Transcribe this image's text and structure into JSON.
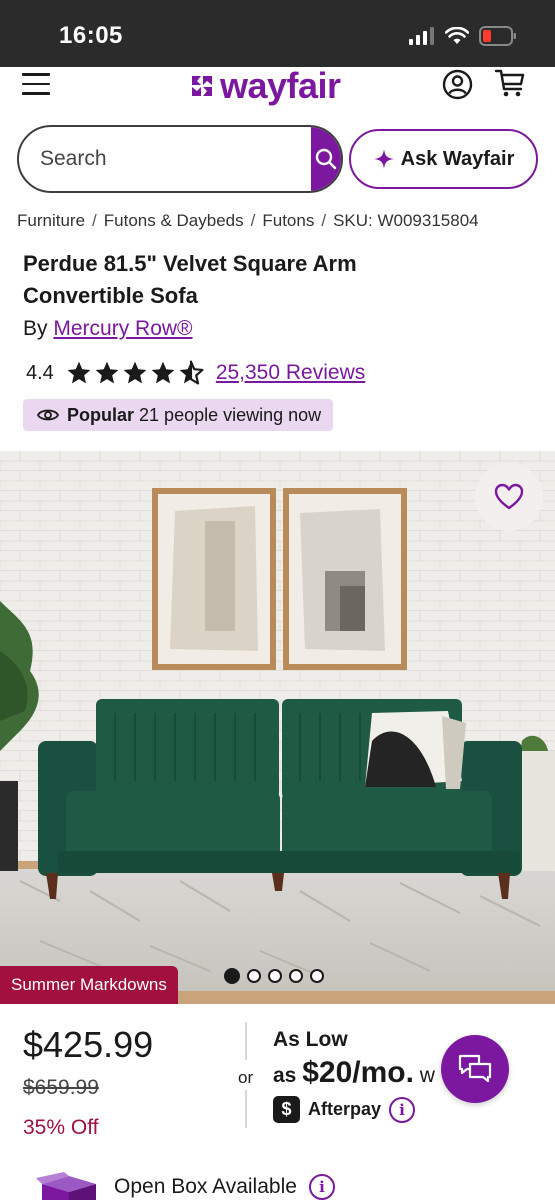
{
  "status_bar": {
    "time": "16:05"
  },
  "header": {
    "logo_text": "wayfair"
  },
  "search": {
    "placeholder": "Search"
  },
  "ask_button": {
    "label": "Ask Wayfair"
  },
  "breadcrumb": [
    "Furniture",
    "Futons & Daybeds",
    "Futons",
    "SKU: W009315804"
  ],
  "product": {
    "title": "Perdue 81.5\" Velvet Square Arm Convertible Sofa",
    "brand_prefix": "By",
    "brand": "Mercury Row®",
    "rating": "4.4",
    "stars": 4.4,
    "reviews": "25,350 Reviews",
    "popular_label": "Popular",
    "popular_text": "21 people viewing now"
  },
  "gallery": {
    "tag": "Summer Markdowns",
    "image_count": 5,
    "active_index": 0
  },
  "pricing": {
    "price": "$425.99",
    "original_price": "$659.99",
    "discount": "35% Off",
    "or": "or",
    "as_low_label": "As Low",
    "as_prefix": "as",
    "monthly": "$20/mo.",
    "monthly_tail": "w",
    "afterpay_label": "Afterpay",
    "afterpay_glyph": "$",
    "info_glyph": "i"
  },
  "open_box": {
    "label": "Open Box Available",
    "info_glyph": "i"
  },
  "colors": {
    "brand_purple": "#7b189f",
    "markdown_red": "#a1103f",
    "badge_lilac": "#ead7f0",
    "sofa_green": "#1f5a45"
  }
}
